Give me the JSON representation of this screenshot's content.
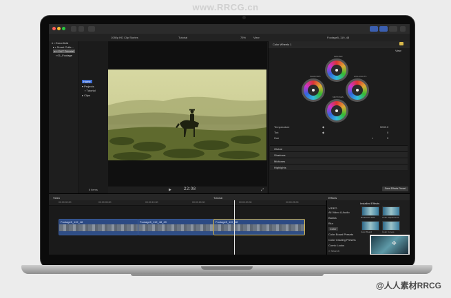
{
  "watermarks": {
    "top": "www.RRCG.cn",
    "bottom": "@人人素材RRCG"
  },
  "colors": {
    "accent": "#3d6bd0",
    "clip": "#3a5a98",
    "selected_clip_border": "#d8b84a"
  },
  "viewbar": {
    "left": "1080p HD Clip Stories",
    "center": "Tutorial",
    "zoom": "75%",
    "view": "View",
    "clip_name": "Footage5_119_48"
  },
  "sidebar": {
    "items": [
      {
        "label": "Greenfield",
        "icon": "library-icon"
      },
      {
        "label": "Smart Colle...",
        "icon": "folder-icon"
      },
      {
        "label": "DUT Tutorial",
        "icon": "event-icon"
      },
      {
        "label": "01_Footage",
        "icon": "event-icon"
      }
    ]
  },
  "browser": {
    "items": [
      {
        "label": "Home"
      },
      {
        "label": "Projects"
      },
      {
        "label": "Tutorial"
      },
      {
        "label": "Clips"
      }
    ],
    "count": "6 items"
  },
  "viewer": {
    "timecode": "22:08",
    "play_icon": "play-icon"
  },
  "inspector": {
    "title": "Color Wheels 1",
    "view": "View",
    "wheels": [
      "MASTER",
      "SHADOWS",
      "HIGHLIGHTS",
      "MIDTONES"
    ],
    "sliders": [
      {
        "label": "Temperature",
        "value": "5000.0"
      },
      {
        "label": "Tint",
        "value": "0"
      },
      {
        "label": "Hue",
        "value": "0"
      }
    ],
    "sections": [
      "Global",
      "Shadows",
      "Midtones",
      "Highlights"
    ],
    "save_preset": "Save Effects Preset"
  },
  "timeline": {
    "index_label": "Video",
    "project": "Tutorial",
    "ruler": [
      "00:00:00:00",
      "00:00:05:00",
      "00:00:10:00",
      "00:00:15:00",
      "00:00:20:00",
      "00:00:25:00"
    ],
    "clips": [
      {
        "label": "Footage5_119_48"
      },
      {
        "label": "Footage5_119_48_49"
      },
      {
        "label": "Footage5_119_48"
      }
    ]
  },
  "effects": {
    "title": "Effects",
    "installed": "Installed Effects",
    "categories": [
      "VIDEO",
      "All Video & Audio",
      "Basics",
      "Blur",
      "Color",
      "Color Board Presets",
      "Color Grading Presets",
      "Comic Looks"
    ],
    "selected_category": "Color",
    "thumbs": [
      "Broadcast Safe",
      "Color Adjustments",
      "Color Board",
      "Color Curves"
    ],
    "search": "Search"
  }
}
